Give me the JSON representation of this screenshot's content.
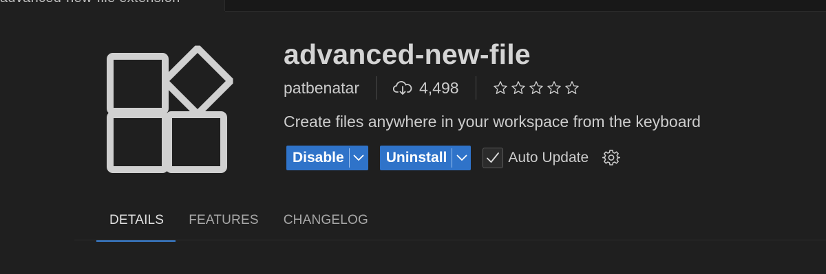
{
  "topbar": {
    "left_tab_text": "advanced-new-file extension"
  },
  "extension": {
    "title": "advanced-new-file",
    "publisher": "patbenatar",
    "install_count": "4,498",
    "rating_stars": 0,
    "description": "Create files anywhere in your workspace from the keyboard"
  },
  "actions": {
    "disable_label": "Disable",
    "uninstall_label": "Uninstall",
    "auto_update_label": "Auto Update",
    "auto_update_checked": true
  },
  "tabs": [
    {
      "label": "DETAILS",
      "active": true
    },
    {
      "label": "FEATURES",
      "active": false
    },
    {
      "label": "CHANGELOG",
      "active": false
    }
  ],
  "icons": {
    "extension": "extensions-blocks-icon",
    "download": "cloud-download-icon",
    "star": "star-outline-icon",
    "chevron": "chevron-down-icon",
    "check": "checkmark-icon",
    "settings": "gear-icon"
  },
  "colors": {
    "background": "#1f1f1f",
    "button_primary": "#2f73c9",
    "tab_active_underline": "#3b82d6",
    "text": "#cccccc"
  }
}
